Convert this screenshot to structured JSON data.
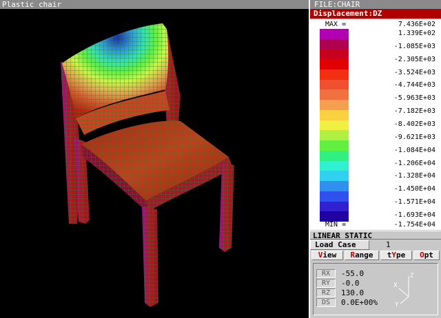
{
  "viewport": {
    "title": "Plastic chair"
  },
  "panel": {
    "file_title": "FILE:CHAIR",
    "result_title": "Displacement:DZ",
    "legend": {
      "max_tag": "MAX =",
      "min_tag": "MIN =",
      "labels": [
        "7.436E+02",
        "1.339E+02",
        "-1.085E+03",
        "-2.305E+03",
        "-3.524E+03",
        "-4.744E+03",
        "-5.963E+03",
        "-7.182E+03",
        "-8.402E+03",
        "-9.621E+03",
        "-1.084E+04",
        "-1.206E+04",
        "-1.328E+04",
        "-1.450E+04",
        "-1.571E+04",
        "-1.693E+04",
        "-1.754E+04"
      ],
      "colors": [
        "#b000b0",
        "#b00050",
        "#c80020",
        "#e00000",
        "#f03010",
        "#f05030",
        "#f07040",
        "#f4a050",
        "#f8d040",
        "#f0f040",
        "#b0f040",
        "#60f040",
        "#30f080",
        "#30f0d0",
        "#30d0f0",
        "#3090f0",
        "#3050f0",
        "#3020d0",
        "#2000a0"
      ]
    },
    "analysis_type": "LINEAR STATIC",
    "load_case": {
      "label": "Load Case",
      "value": "1"
    },
    "menu": [
      {
        "hotkey": "V",
        "rest": "iew"
      },
      {
        "hotkey": "R",
        "rest": "ange"
      },
      {
        "pre": "t",
        "hotkey": "Y",
        "rest": "pe"
      },
      {
        "hotkey": "O",
        "rest": "pt"
      }
    ],
    "view": {
      "rows": [
        {
          "tag": "RX",
          "value": "-55.0"
        },
        {
          "tag": "RY",
          "value": "-0.0"
        },
        {
          "tag": "RZ",
          "value": "130.0"
        },
        {
          "tag": "DS",
          "value": "0.0E+00%"
        }
      ],
      "axes": {
        "x": "X",
        "y": "Y",
        "z": "Z"
      }
    }
  }
}
